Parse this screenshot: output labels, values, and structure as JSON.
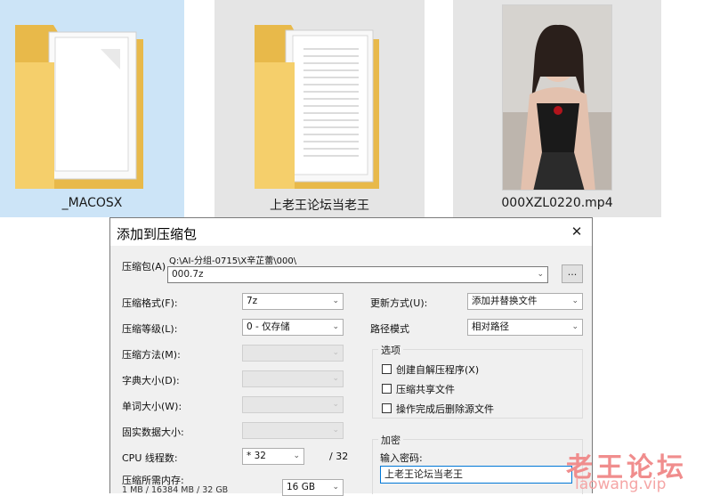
{
  "explorer": {
    "items": [
      {
        "name": "_MACOSX",
        "type": "folder",
        "state": "selected"
      },
      {
        "name": "上老王论坛当老王",
        "type": "folder"
      },
      {
        "name": "000XZL0220.mp4",
        "type": "video"
      }
    ]
  },
  "dialog": {
    "title": "添加到压缩包",
    "close_glyph": "✕",
    "archive": {
      "label": "压缩包(A)",
      "folder_path": "Q:\\AI-分组-0715\\X辛芷蕾\\000\\",
      "value": "000.7z",
      "browse_label": "..."
    },
    "left_fields": [
      {
        "label": "压缩格式(F):",
        "value": "7z",
        "enabled": true
      },
      {
        "label": "压缩等级(L):",
        "value": "0 - 仅存储",
        "enabled": true
      },
      {
        "label": "压缩方法(M):",
        "value": "",
        "enabled": false
      },
      {
        "label": "字典大小(D):",
        "value": "",
        "enabled": false
      },
      {
        "label": "单词大小(W):",
        "value": "",
        "enabled": false
      },
      {
        "label": "固实数据大小:",
        "value": "",
        "enabled": false
      }
    ],
    "cpu": {
      "label": "CPU 线程数:",
      "value": "* 32",
      "max": "/ 32"
    },
    "memory": {
      "label": "压缩所需内存:",
      "detail": "1 MB / 16384 MB / 32 GB",
      "value": "16 GB"
    },
    "update_mode": {
      "label": "更新方式(U):",
      "value": "添加并替换文件"
    },
    "path_mode": {
      "label": "路径模式",
      "value": "相对路径"
    },
    "options": {
      "title": "选项",
      "items": [
        {
          "label": "创建自解压程序(X)",
          "checked": false
        },
        {
          "label": "压缩共享文件",
          "checked": false
        },
        {
          "label": "操作完成后删除源文件",
          "checked": false
        }
      ]
    },
    "encryption": {
      "title": "加密",
      "password_label": "输入密码:",
      "password_value": "上老王论坛当老王"
    }
  },
  "watermark": {
    "main": "老王论坛",
    "sub": "laowang.vip"
  },
  "colors": {
    "selection": "#cce4f7",
    "tile": "#e5e5e5",
    "folder": "#f5cf6b",
    "watermark": "#f08d8d"
  }
}
